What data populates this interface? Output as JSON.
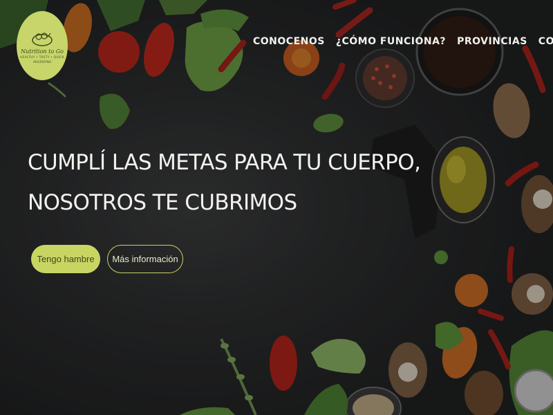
{
  "header": {
    "logo": {
      "name": "Nutrition to Go",
      "tagline": "HEALTHY • TASTY • QUICK",
      "footer": "ARGENTINA"
    },
    "nav": [
      {
        "label": "CONOCENOS"
      },
      {
        "label": "¿CÓMO FUNCIONA?"
      },
      {
        "label": "PROVINCIAS"
      },
      {
        "label": "CONTACTO"
      }
    ]
  },
  "hero": {
    "headline_line1": "CUMPLÍ LAS METAS PARA TU CUERPO,",
    "headline_line2": "NOSOTROS TE CUBRIMOS",
    "primary_button": "Tengo hambre",
    "secondary_button": "Más información"
  },
  "colors": {
    "accent": "#c8d562",
    "background": "#2c2d2e",
    "text": "#f2f2ef"
  }
}
